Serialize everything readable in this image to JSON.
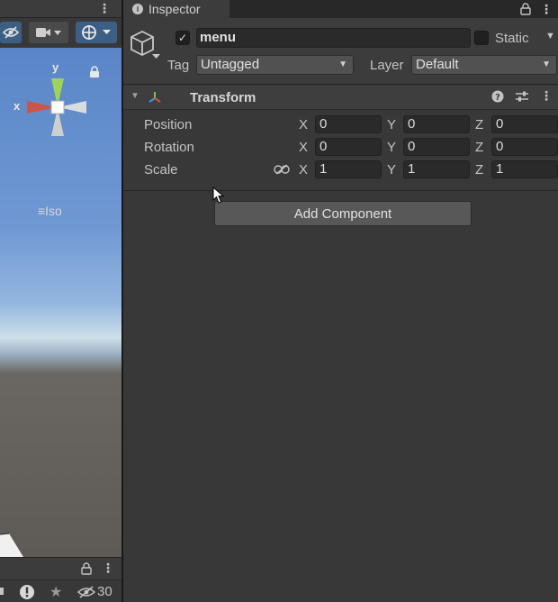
{
  "inspector": {
    "tab_label": "Inspector",
    "object_name": "menu",
    "static_label": "Static",
    "tag_label": "Tag",
    "tag_value": "Untagged",
    "layer_label": "Layer",
    "layer_value": "Default"
  },
  "transform": {
    "title": "Transform",
    "position_label": "Position",
    "rotation_label": "Rotation",
    "scale_label": "Scale",
    "position": {
      "x": "0",
      "y": "0",
      "z": "0"
    },
    "rotation": {
      "x": "0",
      "y": "0",
      "z": "0"
    },
    "scale": {
      "x": "1",
      "y": "1",
      "z": "1"
    },
    "axis_x": "X",
    "axis_y": "Y",
    "axis_z": "Z"
  },
  "add_component_label": "Add Component",
  "scene": {
    "gizmo_y": "y",
    "gizmo_x": "x",
    "projection_label": "Iso",
    "hidden_count": "30"
  },
  "colors": {
    "accent_blue": "#3d5f86",
    "gizmo_y": "#9fd35a",
    "gizmo_x": "#c9564a"
  }
}
